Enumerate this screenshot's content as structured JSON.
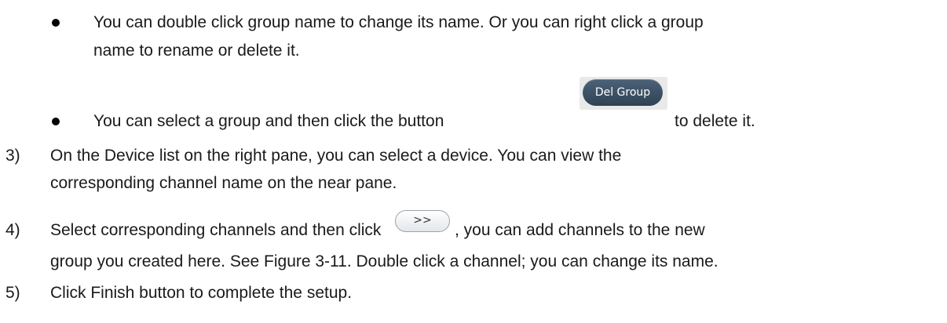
{
  "bullets": [
    {
      "line1": "You can double click group name to change its name. Or you can right click a group",
      "line2": "name to rename or delete it."
    },
    {
      "before": "You can select a group and then click the button",
      "after": "to delete it."
    }
  ],
  "buttons": {
    "del_group": "Del Group",
    "add_arrow": ">>"
  },
  "steps": [
    {
      "number": "3)",
      "line1": "On the Device list on the right pane, you can select a device. You can view the",
      "line2": "corresponding channel name on the near pane."
    },
    {
      "number": "4)",
      "before": "Select corresponding channels and then click",
      "after": ", you can add channels to the new",
      "line2": "group you created here. See Figure 3-11. Double click a channel; you can change its name."
    },
    {
      "number": "5)",
      "line1": "Click Finish button to complete the setup."
    }
  ]
}
